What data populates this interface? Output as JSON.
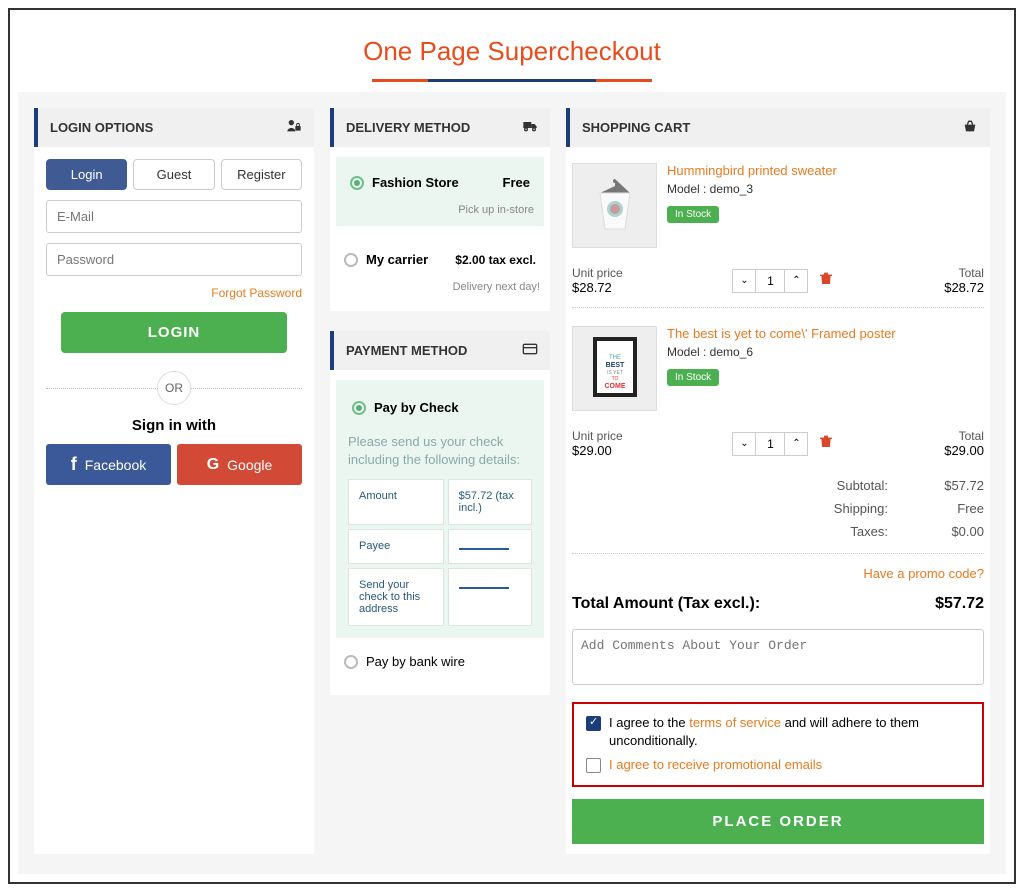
{
  "pageTitle": "One Page Supercheckout",
  "login": {
    "heading": "LOGIN OPTIONS",
    "tabs": {
      "login": "Login",
      "guest": "Guest",
      "register": "Register"
    },
    "emailPlaceholder": "E-Mail",
    "passwordPlaceholder": "Password",
    "forgot": "Forgot Password",
    "loginBtn": "LOGIN",
    "or": "OR",
    "signInWith": "Sign in with",
    "facebook": "Facebook",
    "google": "Google"
  },
  "delivery": {
    "heading": "DELIVERY METHOD",
    "opt1": {
      "name": "Fashion Store",
      "price": "Free",
      "sub": "Pick up in-store"
    },
    "opt2": {
      "name": "My carrier",
      "price": "$2.00 tax excl.",
      "sub": "Delivery next day!"
    }
  },
  "payment": {
    "heading": "PAYMENT METHOD",
    "opt1": {
      "name": "Pay by Check",
      "note": "Please send us your check including the following details:",
      "rows": {
        "amountLabel": "Amount",
        "amountVal": "$57.72 (tax incl.)",
        "payeeLabel": "Payee",
        "addrLabel": "Send your check to this address"
      }
    },
    "opt2": {
      "name": "Pay by bank wire"
    }
  },
  "cart": {
    "heading": "SHOPPING CART",
    "items": [
      {
        "name": "Hummingbird printed sweater",
        "model": "Model : demo_3",
        "stock": "In Stock",
        "unitLabel": "Unit price",
        "unitPrice": "$28.72",
        "qty": "1",
        "totalLabel": "Total",
        "total": "$28.72"
      },
      {
        "name": "The best is yet to come\\' Framed poster",
        "model": "Model : demo_6",
        "stock": "In Stock",
        "unitLabel": "Unit price",
        "unitPrice": "$29.00",
        "qty": "1",
        "totalLabel": "Total",
        "total": "$29.00"
      }
    ],
    "subtotal": {
      "label": "Subtotal:",
      "val": "$57.72"
    },
    "shipping": {
      "label": "Shipping:",
      "val": "Free"
    },
    "taxes": {
      "label": "Taxes:",
      "val": "$0.00"
    },
    "promo": "Have a promo code?",
    "grand": {
      "label": "Total Amount (Tax excl.):",
      "val": "$57.72"
    },
    "commentPlaceholder": "Add Comments About Your Order",
    "consent1a": "I agree to the ",
    "consent1b": "terms of service",
    "consent1c": " and will adhere to them unconditionally.",
    "consent2": "I agree to receive promotional emails",
    "placeOrder": "PLACE ORDER"
  }
}
